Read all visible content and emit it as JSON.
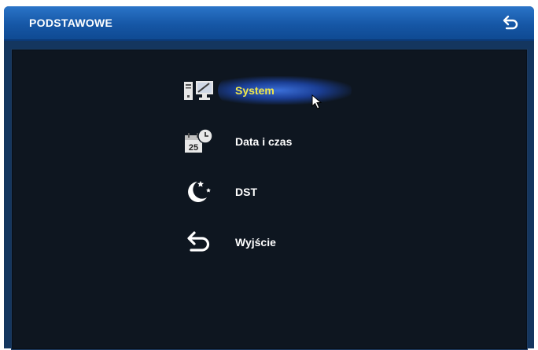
{
  "window": {
    "title": "PODSTAWOWE"
  },
  "menu": {
    "items": [
      {
        "label": "System",
        "icon": "computer-icon",
        "selected": true
      },
      {
        "label": "Data i czas",
        "icon": "calendar-clock-icon",
        "selected": false
      },
      {
        "label": "DST",
        "icon": "moon-stars-icon",
        "selected": false
      },
      {
        "label": "Wyjście",
        "icon": "back-arrow-icon",
        "selected": false
      }
    ]
  },
  "colors": {
    "title_bar": "#1a5fb2",
    "background": "#0e1620",
    "selected_text": "#f1e84a",
    "text": "#ffffff"
  }
}
